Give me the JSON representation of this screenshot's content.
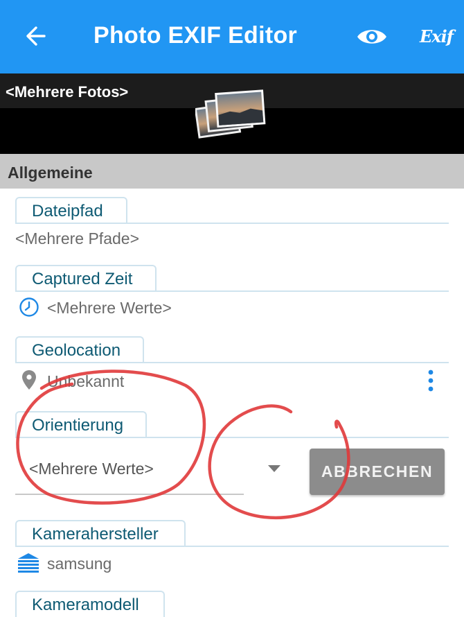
{
  "appbar": {
    "title": "Photo EXIF Editor",
    "exif_label": "Exif",
    "color": "#2196f3"
  },
  "banner": {
    "label": "<Mehrere Fotos>"
  },
  "section": {
    "title": "Allgemeine"
  },
  "fields": {
    "filepath": {
      "label": "Dateipfad",
      "value": "<Mehrere Pfade>"
    },
    "captured": {
      "label": "Captured Zeit",
      "value": "<Mehrere Werte>"
    },
    "geolocation": {
      "label": "Geolocation",
      "value": "Unbekannt"
    },
    "orientation": {
      "label": "Orientierung",
      "value": "<Mehrere Werte>"
    },
    "maker": {
      "label": "Kamerahersteller",
      "value": "samsung"
    },
    "model": {
      "label": "Kameramodell"
    }
  },
  "cancel_button": {
    "label": "ABBRECHEN"
  },
  "annotation_color": "#e0393a"
}
